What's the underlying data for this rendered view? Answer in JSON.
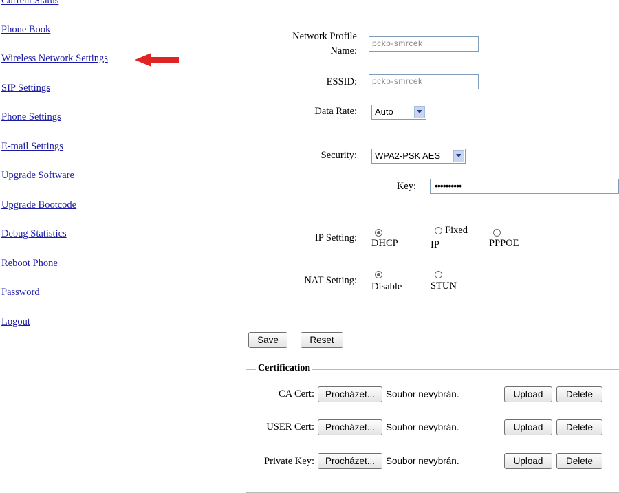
{
  "nav": {
    "items": [
      "Current Status",
      "Phone Book",
      "Wireless Network Settings",
      "SIP Settings",
      "Phone Settings",
      "E-mail Settings",
      "Upgrade Software",
      "Upgrade Bootcode",
      "Debug Statistics",
      "Reboot Phone",
      "Password",
      "Logout"
    ],
    "arrow_color": "#e02424"
  },
  "wireless": {
    "profile_label_1": "Network Profile",
    "profile_label_2": "Name:",
    "profile_value": "pckb-smrcek",
    "essid_label": "ESSID:",
    "essid_value": "pckb-smrcek",
    "data_rate_label": "Data Rate:",
    "data_rate_value": "Auto",
    "security_label": "Security:",
    "security_value": "WPA2-PSK AES",
    "key_label": "Key:",
    "key_value": "••••••••••",
    "ip_label": "IP Setting:",
    "ip_options": [
      "DHCP",
      "Fixed",
      "IP",
      "PPPOE"
    ],
    "ip_selected": "DHCP",
    "nat_label": "NAT Setting:",
    "nat_options": [
      "Disable",
      "STUN"
    ],
    "nat_selected": "Disable"
  },
  "actions": {
    "save": "Save",
    "reset": "Reset"
  },
  "certification": {
    "legend": "Certification",
    "browse_label": "Procházet...",
    "no_file": "Soubor nevybrán.",
    "upload": "Upload",
    "delete": "Delete",
    "rows": [
      "CA Cert:",
      "USER Cert:",
      "Private Key:"
    ]
  }
}
